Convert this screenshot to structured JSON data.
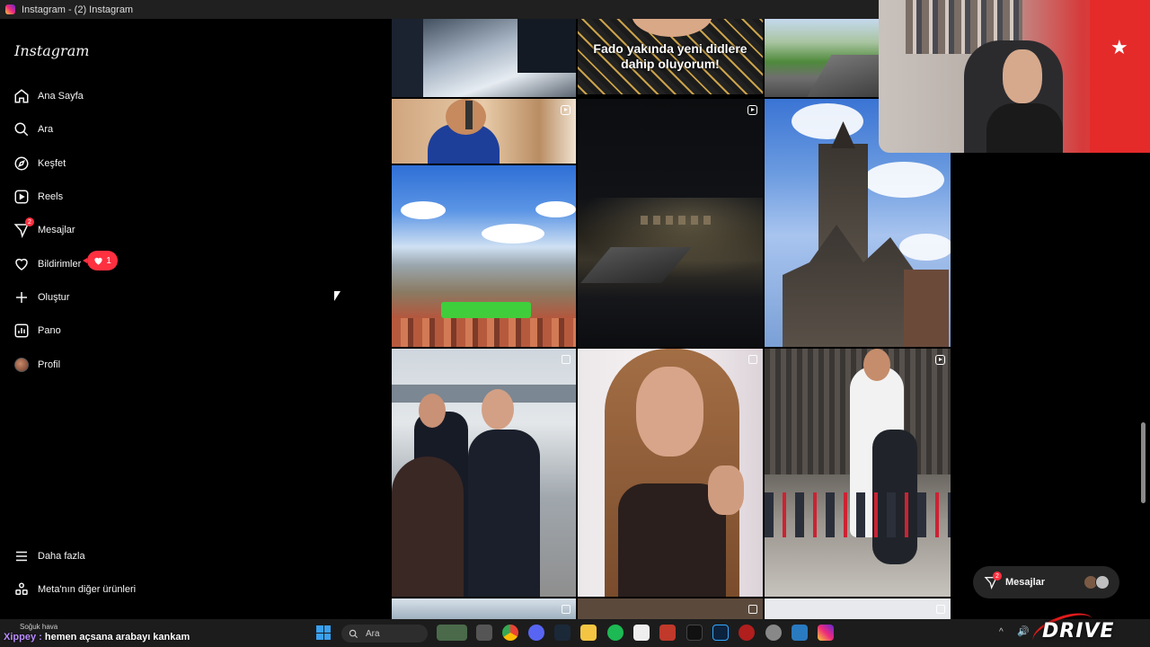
{
  "window": {
    "title": "Instagram - (2) Instagram"
  },
  "sidebar": {
    "logo": "Instagram",
    "items": [
      {
        "label": "Ana Sayfa",
        "icon": "home-icon"
      },
      {
        "label": "Ara",
        "icon": "search-icon"
      },
      {
        "label": "Keşfet",
        "icon": "compass-icon"
      },
      {
        "label": "Reels",
        "icon": "reels-icon"
      },
      {
        "label": "Mesajlar",
        "icon": "messenger-icon",
        "badge": "2"
      },
      {
        "label": "Bildirimler",
        "icon": "heart-icon"
      },
      {
        "label": "Oluştur",
        "icon": "plus-icon"
      },
      {
        "label": "Pano",
        "icon": "chart-icon"
      },
      {
        "label": "Profil",
        "icon": "avatar-icon"
      }
    ],
    "notification_count": "1",
    "bottom_items": [
      {
        "label": "Daha fazla",
        "icon": "menu-icon"
      },
      {
        "label": "Meta'nın diğer ürünleri",
        "icon": "grid-apps-icon"
      }
    ]
  },
  "grid": {
    "overlay_caption_line1": "Fado yakında yeni didlere",
    "overlay_caption_line2": "dahip oluyorum!",
    "tiles": [
      {
        "desc": "partial-top-left",
        "kind": "photo"
      },
      {
        "desc": "fado-caption",
        "kind": "photo"
      },
      {
        "desc": "road-partial",
        "kind": "photo"
      },
      {
        "desc": "man-holding-object",
        "kind": "reel"
      },
      {
        "desc": "night-road-boars",
        "kind": "reel"
      },
      {
        "desc": "prague-clock-tower",
        "kind": "photo"
      },
      {
        "desc": "prague-city-view",
        "kind": "photo"
      },
      {
        "desc": "politicians-walking",
        "kind": "multi"
      },
      {
        "desc": "woman-speaking",
        "kind": "multi"
      },
      {
        "desc": "friends-piggyback",
        "kind": "reel"
      }
    ]
  },
  "messages_pill": {
    "label": "Mesajlar",
    "badge": "2"
  },
  "taskbar": {
    "weather": "Soğuk hava",
    "search_label": "Ara",
    "chat_user": "Xippey :",
    "chat_message": " hemen açsana arabayı kankam"
  },
  "watermark": "DRIVE",
  "colors": {
    "accent": "#ff3040",
    "background": "#000000",
    "sidebar_text": "#f5f5f5"
  }
}
